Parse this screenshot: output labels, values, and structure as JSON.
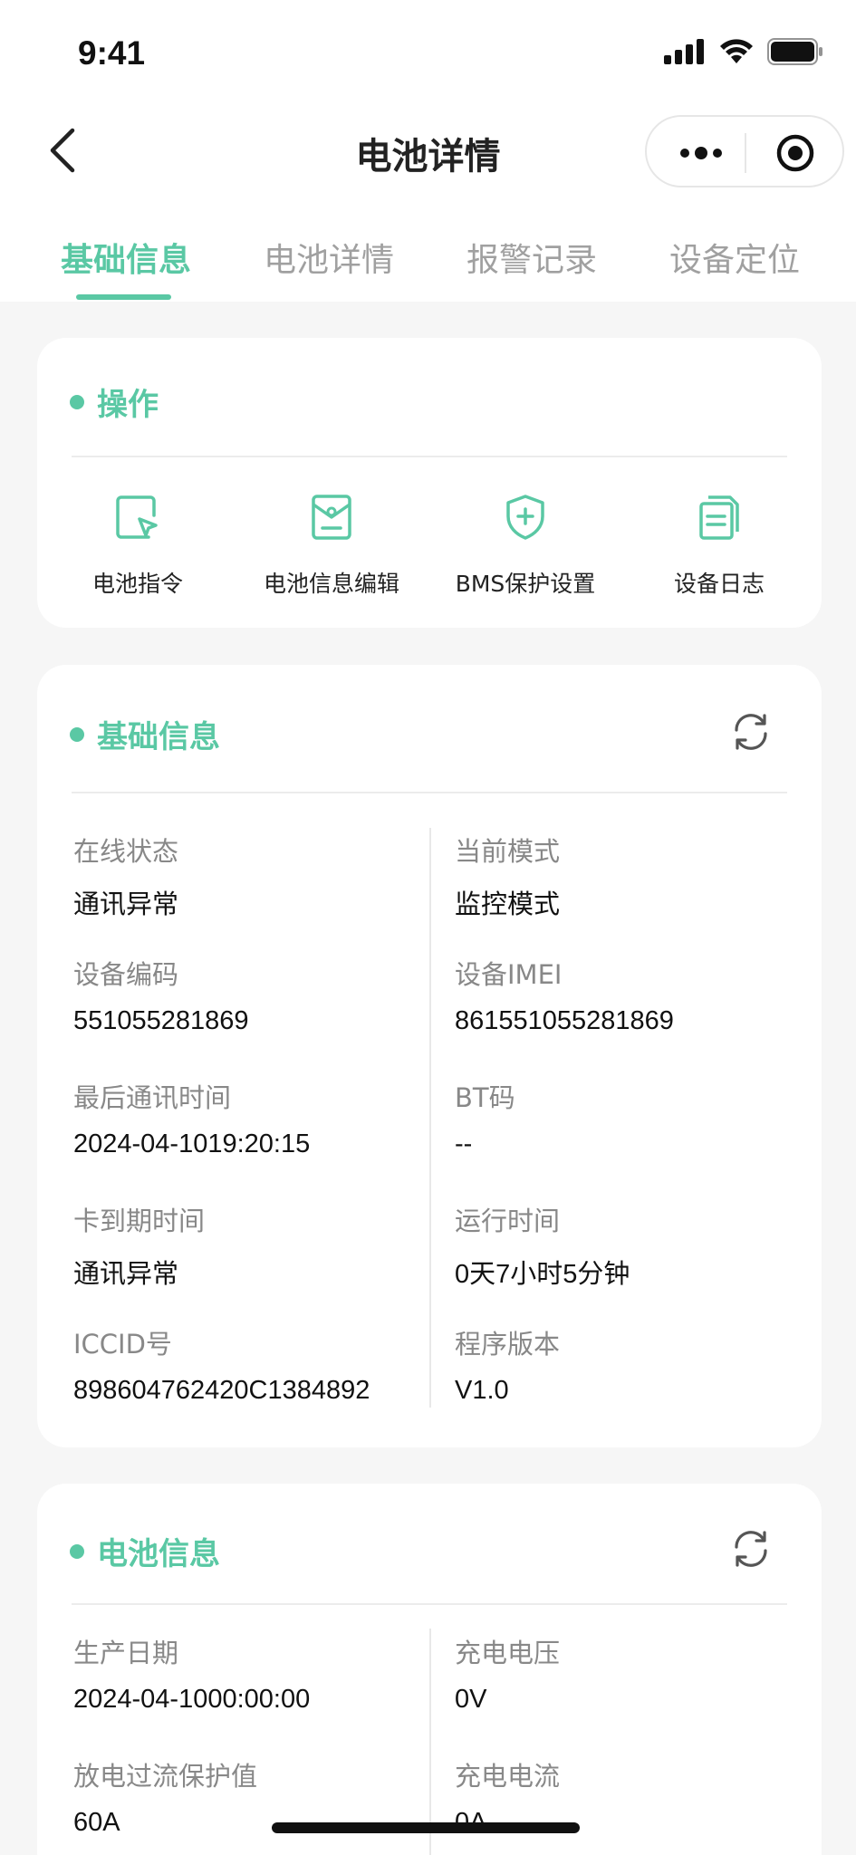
{
  "status_bar": {
    "time": "9:41"
  },
  "nav": {
    "title": "电池详情"
  },
  "tabs": [
    {
      "label": "基础信息",
      "active": true
    },
    {
      "label": "电池详情",
      "active": false
    },
    {
      "label": "报警记录",
      "active": false
    },
    {
      "label": "设备定位",
      "active": false
    }
  ],
  "operations": {
    "title": "操作",
    "items": [
      {
        "label": "电池指令",
        "icon": "cursor-window-icon"
      },
      {
        "label": "电池信息编辑",
        "icon": "document-edit-icon"
      },
      {
        "label": "BMS保护设置",
        "icon": "shield-plus-icon"
      },
      {
        "label": "设备日志",
        "icon": "document-copy-icon"
      }
    ]
  },
  "basic_info": {
    "title": "基础信息",
    "left": [
      {
        "label": "在线状态",
        "value": "通讯异常"
      },
      {
        "label": "设备编码",
        "value": "551055281869"
      },
      {
        "label": "最后通讯时间",
        "value": "2024-04-1019:20:15"
      },
      {
        "label": "卡到期时间",
        "value": "通讯异常"
      },
      {
        "label": "ICCID号",
        "value": "898604762420C1384892"
      }
    ],
    "right": [
      {
        "label": "当前模式",
        "value": "监控模式"
      },
      {
        "label": "设备IMEI",
        "value": "861551055281869"
      },
      {
        "label": "BT码",
        "value": "--"
      },
      {
        "label": "运行时间",
        "value": "0天7小时5分钟"
      },
      {
        "label": "程序版本",
        "value": "V1.0"
      }
    ]
  },
  "battery_info": {
    "title": "电池信息",
    "left": [
      {
        "label": "生产日期",
        "value": "2024-04-1000:00:00"
      },
      {
        "label": "放电过流保护值",
        "value": "60A"
      }
    ],
    "right": [
      {
        "label": "充电电压",
        "value": "0V"
      },
      {
        "label": "充电电流",
        "value": "0A"
      }
    ]
  },
  "colors": {
    "accent": "#5ac8a4",
    "background": "#f6f6f6",
    "card": "#ffffff"
  }
}
